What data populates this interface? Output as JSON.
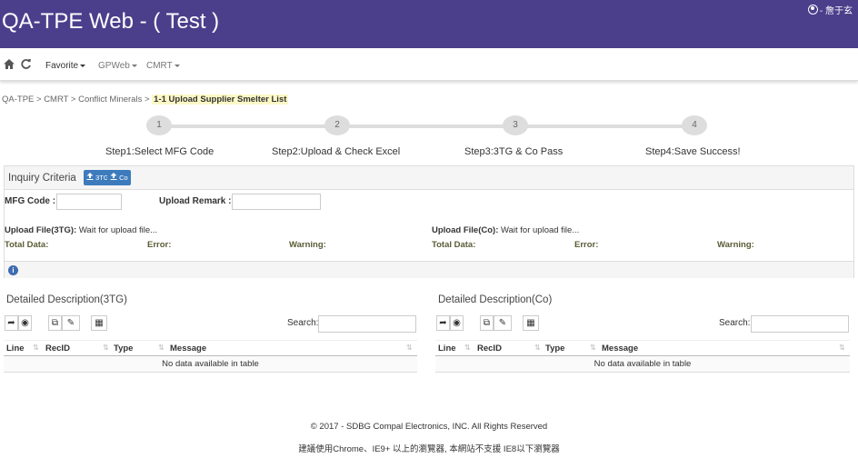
{
  "header": {
    "title": "QA-TPE Web - ( Test )",
    "user": "- 詹于玄"
  },
  "nav": {
    "favorite": "Favorite",
    "gpweb": "GPWeb",
    "cmrt": "CMRT"
  },
  "breadcrumb": {
    "path": "QA-TPE > CMRT > Conflict Minerals >",
    "active": "1-1 Upload Supplier Smelter List"
  },
  "steps": [
    {
      "num": "1",
      "label": "Step1:Select MFG Code"
    },
    {
      "num": "2",
      "label": "Step2:Upload & Check Excel"
    },
    {
      "num": "3",
      "label": "Step3:3TG & Co Pass"
    },
    {
      "num": "4",
      "label": "Step4:Save Success!"
    }
  ],
  "inquiry": {
    "title": "Inquiry Criteria",
    "btn_3tg": "3TG",
    "btn_co": "Co",
    "mfg_label": "MFG Code :",
    "mfg_value": "",
    "remark_label": "Upload Remark :",
    "remark_value": "",
    "file3tg_label": "Upload File(3TG):",
    "file3tg_status": "Wait for upload file...",
    "fileco_label": "Upload File(Co):",
    "fileco_status": "Wait for upload file...",
    "total_data": "Total Data:",
    "error": "Error:",
    "warning": "Warning:"
  },
  "table3tg": {
    "title": "Detailed Description(3TG)"
  },
  "tableco": {
    "title": "Detailed Description(Co)"
  },
  "table": {
    "search_label": "Search:",
    "columns": [
      "Line",
      "RecID",
      "Type",
      "Message"
    ],
    "empty": "No data available in table"
  },
  "footer": {
    "copyright": "© 2017 - SDBG Compal Electronics, INC. All Rights Reserved",
    "notice": "建議使用Chrome、IE9+ 以上的瀏覽器, 本網站不支援 IE8以下瀏覽器"
  }
}
